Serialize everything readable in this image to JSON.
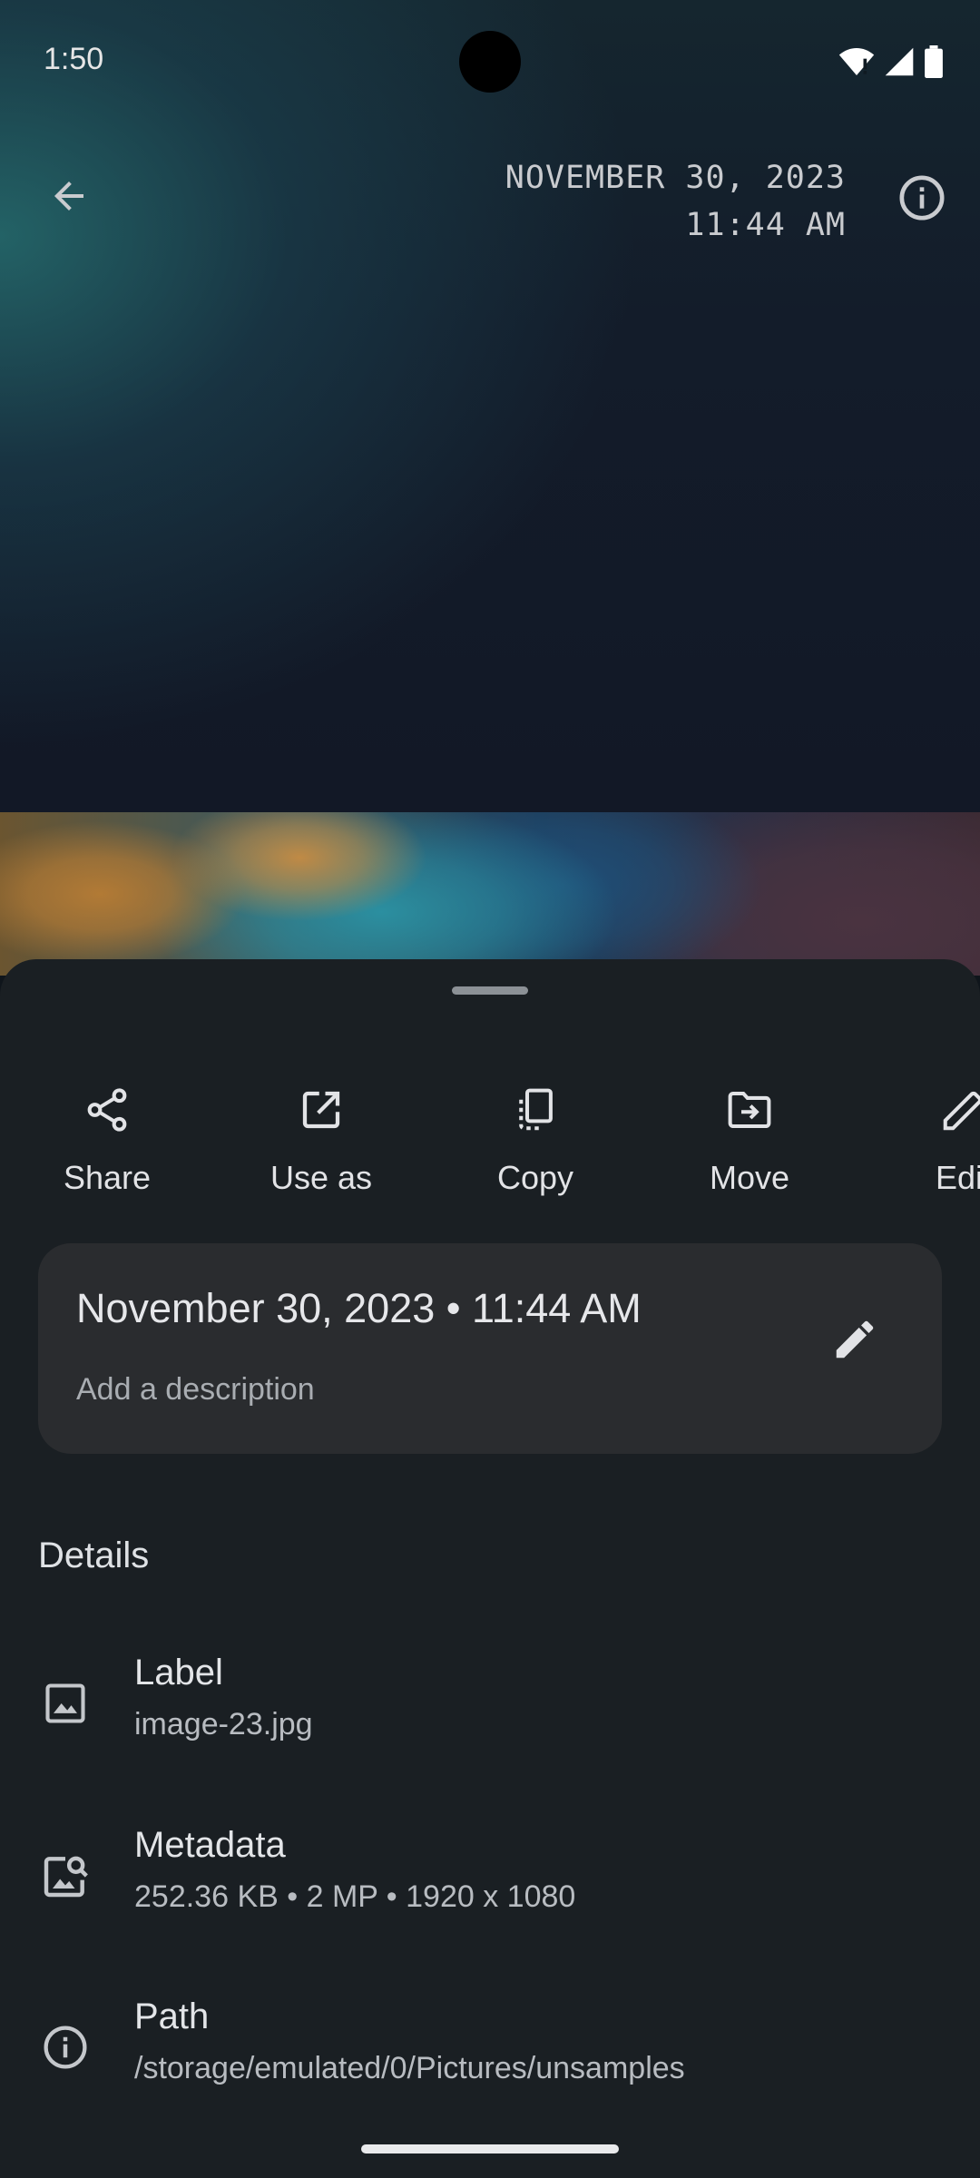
{
  "status_bar": {
    "time": "1:50"
  },
  "viewer": {
    "date_line1": "NOVEMBER 30, 2023",
    "date_line2": "11:44 AM"
  },
  "actions": [
    {
      "label": "Share",
      "icon": "share-icon"
    },
    {
      "label": "Use as",
      "icon": "open-in-new-icon"
    },
    {
      "label": "Copy",
      "icon": "copy-icon"
    },
    {
      "label": "Move",
      "icon": "move-to-folder-icon"
    },
    {
      "label": "Edit",
      "icon": "pencil-icon"
    }
  ],
  "date_card": {
    "title": "November 30, 2023 • 11:44 AM",
    "description_placeholder": "Add a description"
  },
  "details": {
    "heading": "Details",
    "rows": [
      {
        "name": "Label",
        "value": "image-23.jpg",
        "icon": "image-icon"
      },
      {
        "name": "Metadata",
        "value": "252.36 KB • 2 MP • 1920 x 1080",
        "icon": "image-search-icon"
      },
      {
        "name": "Path",
        "value": "/storage/emulated/0/Pictures/unsamples",
        "icon": "info-icon"
      }
    ]
  },
  "colors": {
    "sheet_background": "#1a1f23",
    "card_background": "#2a2c2f",
    "text_primary": "#e2e3e6",
    "text_secondary": "#a9adb2"
  }
}
